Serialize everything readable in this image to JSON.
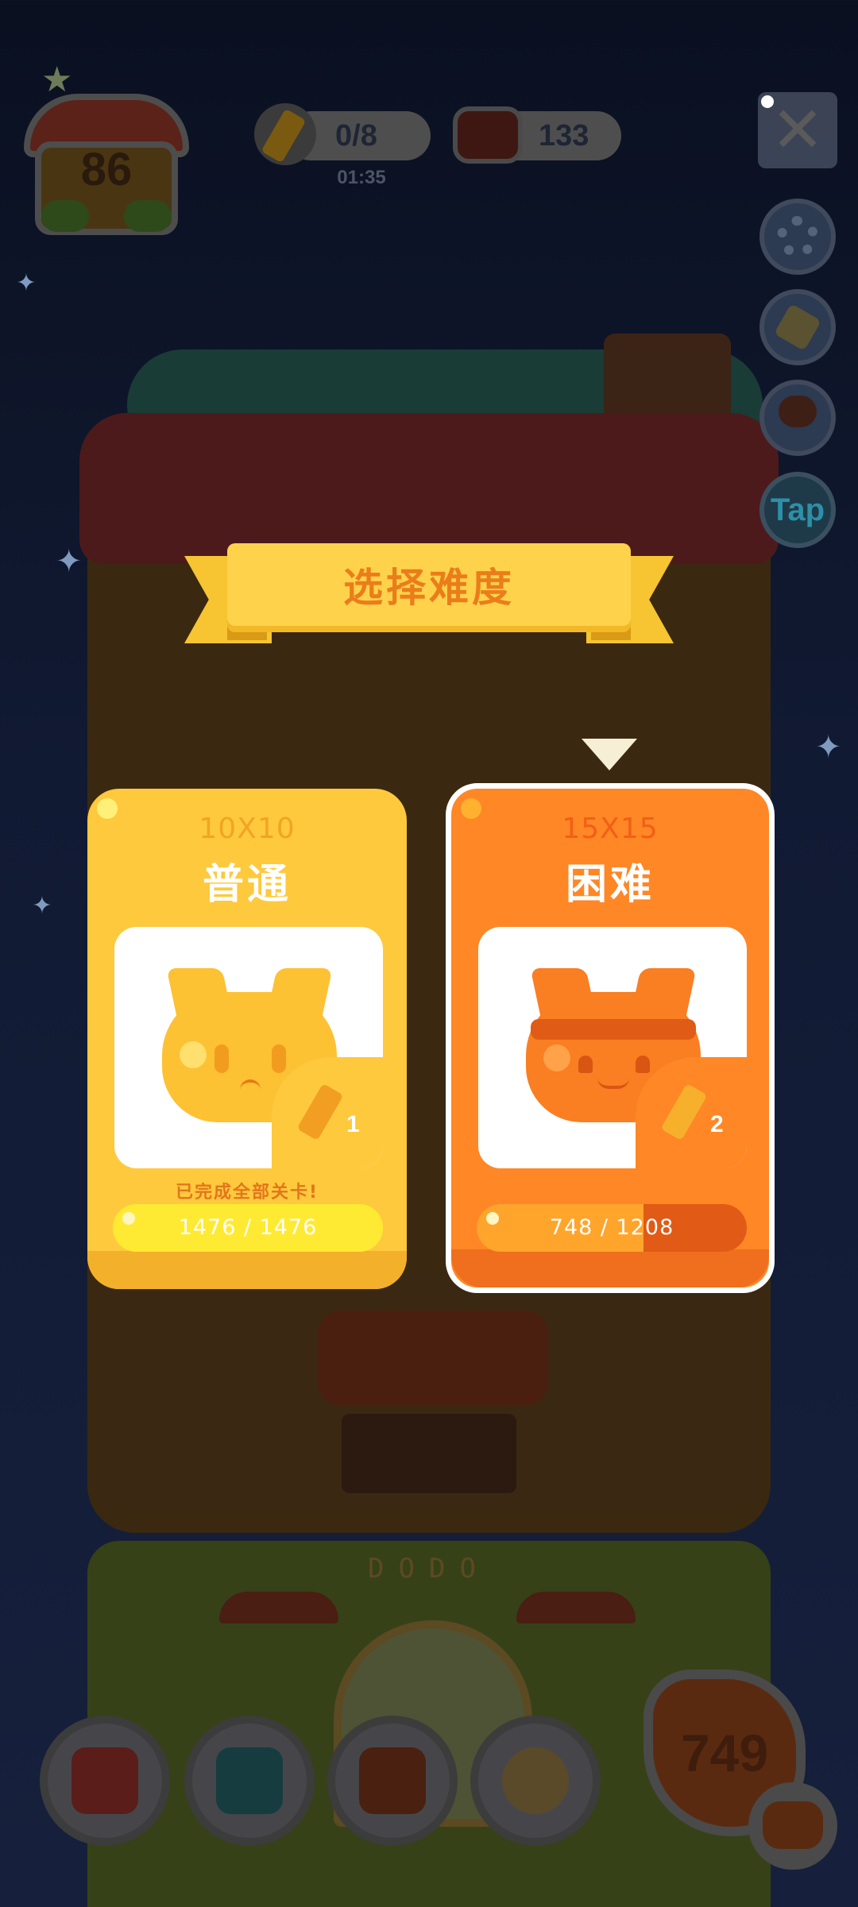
{
  "hud": {
    "house_level": "86",
    "pencils": "0/8",
    "timer": "01:35",
    "cans": "133",
    "close_icon": "close-icon",
    "tap_label": "Tap"
  },
  "modal": {
    "title": "选择难度",
    "cards": [
      {
        "size": "10X10",
        "label": "普通",
        "pencil_count": "1",
        "status": "已完成全部关卡!",
        "progress_text": "1476 / 1476",
        "progress_fraction": 1.0,
        "selected": false
      },
      {
        "size": "15X15",
        "label": "困难",
        "pencil_count": "2",
        "status": "",
        "progress_text": "748 / 1208",
        "progress_fraction": 0.619,
        "selected": true
      }
    ]
  },
  "scene": {
    "sign": "DODO"
  },
  "bottom_nav": {
    "score": "749",
    "items": [
      "sofa-icon",
      "book-icon",
      "picture-frame-icon",
      "snow-globe-icon"
    ]
  },
  "colors": {
    "normal_card": "#ffc93d",
    "hard_card": "#ff8726",
    "title_text": "#ea7d1a",
    "ribbon": "#ffd24c"
  }
}
